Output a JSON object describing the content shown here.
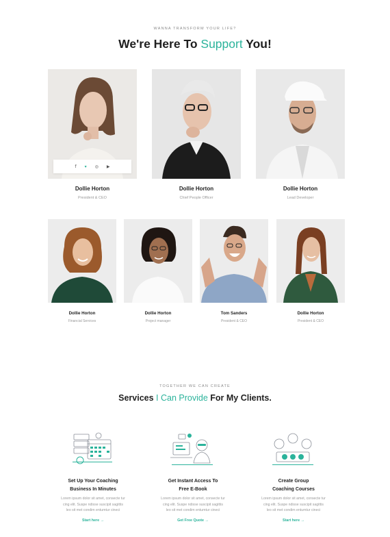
{
  "team": {
    "eyebrow": "WANNA TRANSFORM YOUR LIFE?",
    "title_before": "We're Here To ",
    "title_accent": "Support",
    "title_after": " You!",
    "social": {
      "facebook": "f",
      "twitter": "▾",
      "instagram": "◎",
      "youtube": "▶"
    },
    "row1": [
      {
        "name": "Dollie Horton",
        "role": "President & CEO"
      },
      {
        "name": "Dollie Horton",
        "role": "Chief People Officer"
      },
      {
        "name": "Dollie Horton",
        "role": "Lead Developer"
      }
    ],
    "row2": [
      {
        "name": "Dollie Horton",
        "role": "Financial Services"
      },
      {
        "name": "Dollie Horton",
        "role": "Project manager"
      },
      {
        "name": "Tom Sanders",
        "role": "President & CEO"
      },
      {
        "name": "Dollie Horton",
        "role": "President & CEO"
      }
    ]
  },
  "services": {
    "eyebrow": "TOGETHER WE CAN CREATE",
    "title_before": "Services ",
    "title_accent": "I Can Provide",
    "title_after": " For My Clients.",
    "items": [
      {
        "icon": "calendar-setup-icon",
        "title_l1": "Set Up Your Coaching",
        "title_l2": "Business In Minutes",
        "text_l1": "Lorem ipsum dolor sit amet, consecte tur",
        "text_l2": "cing elit. Suspe ndisse suscipit sagittis",
        "text_l3": "leo sit met condim entumtur cineci",
        "link": "Start here →"
      },
      {
        "icon": "ebook-access-icon",
        "title_l1": "Get Instant Access To",
        "title_l2": "Free E-Book",
        "text_l1": "Lorem ipsum dolor sit amet, consecte tur",
        "text_l2": "cing elit. Suspe ndisse suscipit sagittis",
        "text_l3": "leo sit met condim entumtur cineci",
        "link": "Get Free Quote →"
      },
      {
        "icon": "group-coaching-icon",
        "title_l1": "Create Group",
        "title_l2": "Coaching Courses",
        "text_l1": "Lorem ipsum dolor sit amet, consecte tur",
        "text_l2": "cing elit. Suspe ndisse suscipit sagittis",
        "text_l3": "leo sit met condim entumtur cineci",
        "link": "Start here →"
      }
    ]
  },
  "colors": {
    "accent": "#2bb39b",
    "heading": "#1f1f1f",
    "muted": "#999999",
    "photo_bg": "#ececec"
  }
}
